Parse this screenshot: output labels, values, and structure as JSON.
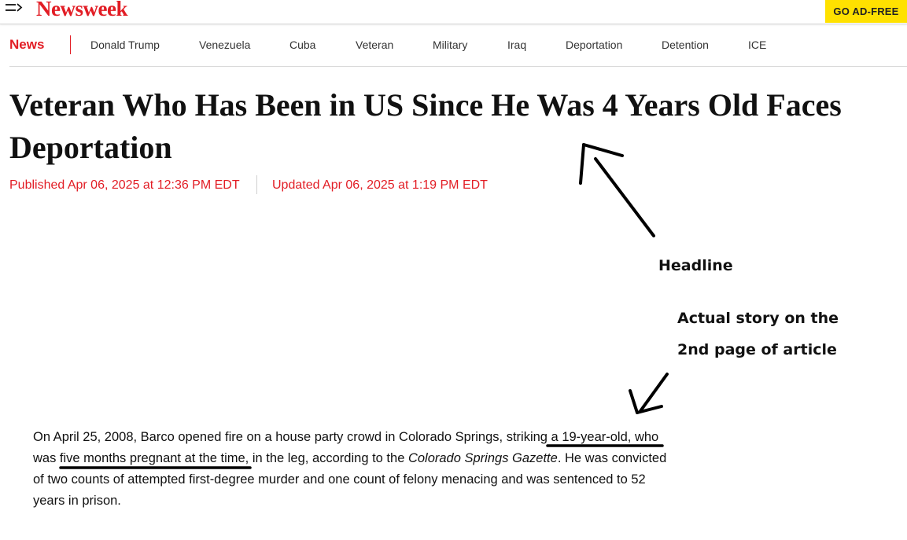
{
  "header": {
    "logo": "Newsweek",
    "ad_free_label": "GO AD-FREE",
    "menu_icon": "menu-arrow-icon",
    "brand_color": "#e21d25",
    "ad_free_color": "#ffe100"
  },
  "nav": {
    "section": "News",
    "items": [
      "Donald Trump",
      "Venezuela",
      "Cuba",
      "Veteran",
      "Military",
      "Iraq",
      "Deportation",
      "Detention",
      "ICE"
    ]
  },
  "article": {
    "headline": "Veteran Who Has Been in US Since He Was 4 Years Old Faces Deportation",
    "published": "Published Apr 06, 2025 at 12:36 PM EDT",
    "updated": "Updated Apr 06, 2025 at 1:19 PM EDT"
  },
  "annotations": {
    "headline_label": "Headline",
    "story_label_line1": "Actual story on the",
    "story_label_line2": "2nd page of article"
  },
  "story": {
    "part1": "On April 25, 2008, Barco opened fire on a house party crowd in Colorado Springs,",
    "highlight1": " striking a 19-year-old,",
    "space1": " ",
    "highlight2": "who was five months pregnant",
    "part2": " at the time, in the leg, according to the ",
    "source": "Colorado Springs Gazette",
    "part3": ". He was convicted of two counts of attempted first-degree murder and one count of felony menacing and was sentenced to 52 years in prison."
  }
}
